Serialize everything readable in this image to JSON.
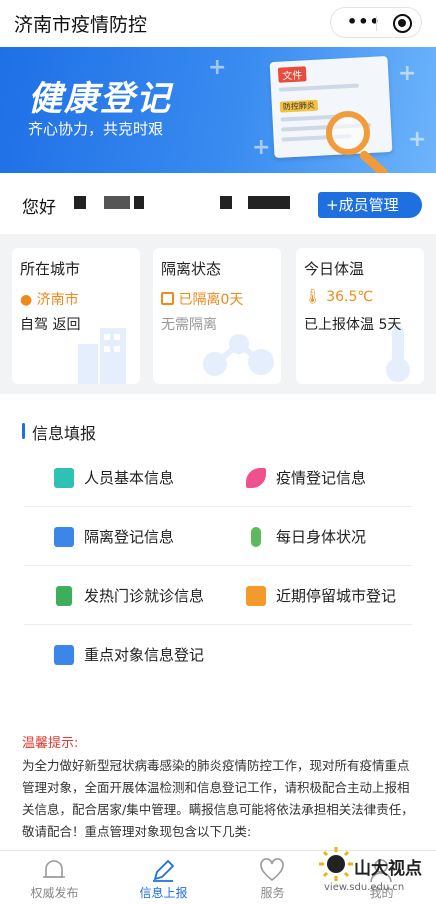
{
  "navbar": {
    "title": "济南市疫情防控",
    "more_icon": "more-dots-icon",
    "close_icon": "target-circle-icon"
  },
  "banner": {
    "title": "健康登记",
    "subtitle": "齐心协力，共克时艰",
    "doc_tag": "文件",
    "doc_sub_tag": "防控肺炎"
  },
  "greeting": {
    "text": "您好",
    "member_button": "+成员管理"
  },
  "status": {
    "city": {
      "title": "所在城市",
      "value": "济南市",
      "note": "自驾 返回"
    },
    "isolation": {
      "title": "隔离状态",
      "value": "已隔离0天",
      "note": "无需隔离"
    },
    "temperature": {
      "title": "今日体温",
      "value": "36.5℃",
      "note_prefix": "已上报体温",
      "note_days": "5天"
    }
  },
  "info": {
    "title": "信息填报",
    "items": [
      {
        "label": "人员基本信息",
        "icon": "id-card-icon",
        "color": "#2ec2b5"
      },
      {
        "label": "疫情登记信息",
        "icon": "feather-icon",
        "color": "#f0508c"
      },
      {
        "label": "隔离登记信息",
        "icon": "form-icon",
        "color": "#3b86e8"
      },
      {
        "label": "每日身体状况",
        "icon": "thermometer-icon",
        "color": "#5cb85c"
      },
      {
        "label": "发热门诊就诊信息",
        "icon": "clinic-icon",
        "color": "#3fae5a"
      },
      {
        "label": "近期停留城市登记",
        "icon": "building-icon",
        "color": "#f39a2b"
      },
      {
        "label": "重点对象信息登记",
        "icon": "user-card-icon",
        "color": "#3b86e8"
      }
    ]
  },
  "notice": {
    "title": "温馨提示:",
    "body": "为全力做好新型冠状病毒感染的肺炎疫情防控工作，现对所有疫情重点管理对象，全面开展体温检测和信息登记工作，请积极配合主动上报相关信息，配合居家/集中管理。瞒报信息可能将依法承担相关法律责任，敬请配合！重点管理对象现包含以下几类:"
  },
  "tabbar": {
    "tabs": [
      {
        "label": "权威发布",
        "icon": "bell-icon"
      },
      {
        "label": "信息上报",
        "icon": "pen-icon"
      },
      {
        "label": "服务",
        "icon": "heart-icon"
      },
      {
        "label": "我的",
        "icon": "user-icon"
      }
    ]
  },
  "watermark": {
    "text": "山大视点",
    "url": "view.sdu.edu.cn"
  }
}
